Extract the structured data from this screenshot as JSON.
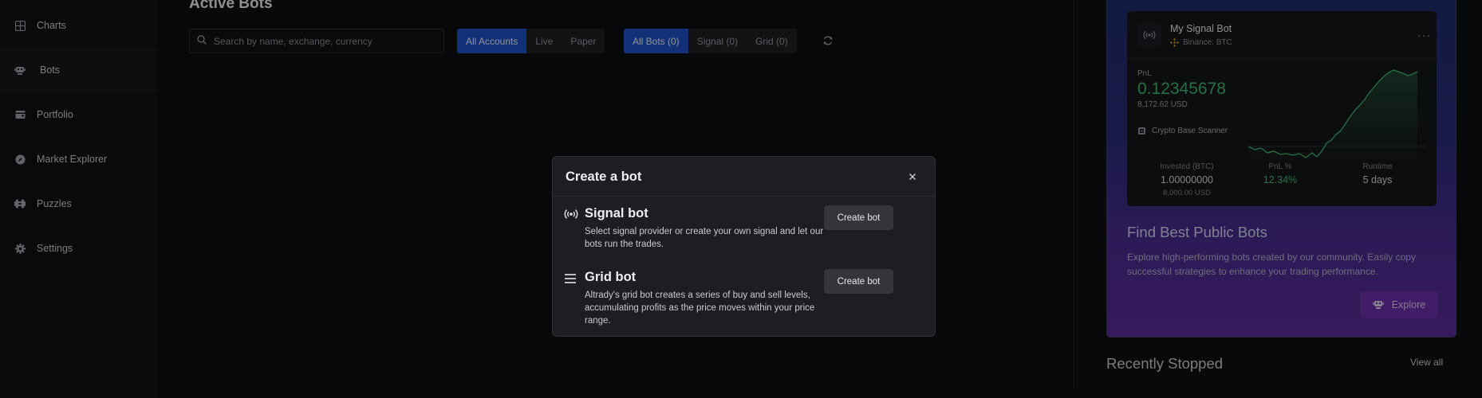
{
  "sidebar": {
    "items": [
      {
        "label": "Charts",
        "icon": "grid-icon"
      },
      {
        "label": "Bots",
        "icon": "robot-icon"
      },
      {
        "label": "Portfolio",
        "icon": "wallet-icon"
      },
      {
        "label": "Market Explorer",
        "icon": "compass-icon"
      },
      {
        "label": "Puzzles",
        "icon": "puzzle-icon"
      },
      {
        "label": "Settings",
        "icon": "gear-icon"
      }
    ],
    "active": "Bots"
  },
  "main": {
    "title": "Active Bots",
    "search_placeholder": "Search by name, exchange, currency",
    "account_filter": [
      "All Accounts",
      "Live",
      "Paper"
    ],
    "account_selected": "All Accounts",
    "bot_filter": [
      "All Bots (0)",
      "Signal (0)",
      "Grid (0)"
    ],
    "bot_selected": "All Bots (0)"
  },
  "promo": {
    "card": {
      "bot_name": "My Signal Bot",
      "exchange": "Binance: BTC",
      "pnl_label": "PnL",
      "pnl_value": "0.12345678",
      "pnl_usd": "8,172.62 USD",
      "scanner": "Crypto Base Scanner",
      "invested_label": "Invested (BTC)",
      "invested_value": "1.00000000",
      "invested_usd": "8,000.00 USD",
      "pnl_pct_label": "PnL %",
      "pnl_pct_value": "12.34%",
      "runtime_label": "Runtime",
      "runtime_value": "5 days"
    },
    "title": "Find Best Public Bots",
    "description": "Explore high-performing bots created by our community. Easily copy successful strategies to enhance your trading performance.",
    "explore_label": "Explore"
  },
  "recent": {
    "title": "Recently Stopped",
    "view_all": "View all"
  },
  "modal": {
    "title": "Create a bot",
    "options": [
      {
        "title": "Signal bot",
        "description": "Select signal provider or create your own signal and let our bots run the trades.",
        "button": "Create bot",
        "icon": "broadcast-icon"
      },
      {
        "title": "Grid bot",
        "description": "Altrady's grid bot creates a series of buy and sell levels, accumulating profits as the price moves within your price range.",
        "button": "Create bot",
        "icon": "menu-lines-icon"
      }
    ]
  },
  "colors": {
    "accent": "#1f4fc2",
    "profit": "#3cb56f",
    "explore": "#6a2fa6"
  }
}
